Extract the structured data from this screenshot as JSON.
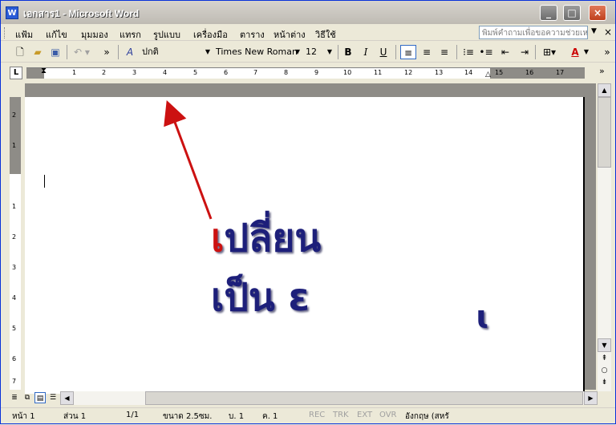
{
  "window": {
    "title": "เอกสาร1 - Microsoft Word",
    "app_icon": "word-icon",
    "controls": {
      "minimize": "_",
      "maximize": "□",
      "close": "×"
    }
  },
  "menubar": {
    "items": [
      "แฟ้ม",
      "แก้ไข",
      "มุมมอง",
      "แทรก",
      "รูปแบบ",
      "เครื่องมือ",
      "ตาราง",
      "หน้าต่าง",
      "วิธีใช้"
    ],
    "help_placeholder": "พิมพ์คำถามเพื่อขอความช่วยเหลือ",
    "close_doc": "×"
  },
  "toolbar": {
    "style": "ปกติ",
    "font": "Times New Roman",
    "size": "12",
    "bold": "B",
    "italic": "I",
    "underline": "U",
    "overflow": "»"
  },
  "ruler": {
    "numbers": [
      "1",
      "2",
      "3",
      "4",
      "5",
      "6",
      "7",
      "8",
      "9",
      "10",
      "11",
      "12",
      "13",
      "14",
      "15",
      "16",
      "17"
    ],
    "vnumbers": [
      "2",
      "1",
      "1",
      "2",
      "3",
      "4",
      "5",
      "6",
      "7"
    ]
  },
  "annotation": {
    "line1_red": "เ",
    "line1": "ปลี่ยน",
    "line2": "เป็น ε",
    "mark": "ɩ",
    "arrow_color": "#cc1111",
    "text_color": "#1d1f7a"
  },
  "statusbar": {
    "page": "หน้า 1",
    "section": "ส่วน 1",
    "pages": "1/1",
    "at": "ขนาด 2.5ซม.",
    "line": "บ. 1",
    "col": "ค. 1",
    "rec": "REC",
    "trk": "TRK",
    "ext": "EXT",
    "ovr": "OVR",
    "language": "อังกฤษ (สหรั"
  }
}
